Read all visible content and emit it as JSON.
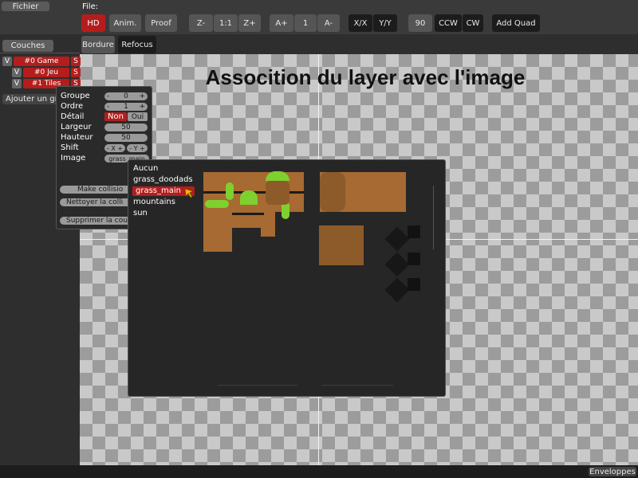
{
  "menubar": {
    "fichier": "Fichier",
    "file_label": "File:"
  },
  "toolbar": {
    "hd": "HD",
    "anim": "Anim.",
    "proof": "Proof",
    "zoom_out": "Z-",
    "zoom_reset": "1:1",
    "zoom_in": "Z+",
    "anim_speed_up": "A+",
    "anim_speed_value": "1",
    "anim_speed_down": "A-",
    "flip_x": "X/X",
    "flip_y": "Y/Y",
    "rotate_90": "90",
    "ccw": "CCW",
    "cw": "CW",
    "add_quad": "Add Quad",
    "border": "Bordure",
    "refocus": "Refocus"
  },
  "sidebar": {
    "tab": "Couches",
    "layers": [
      {
        "v": "V",
        "name": "#0 Game",
        "s": "S"
      },
      {
        "v": "V",
        "name": "#0 Jeu",
        "s": "S"
      },
      {
        "v": "V",
        "name": "#1 Tiles",
        "s": "S"
      }
    ],
    "add_group": "Ajouter un gr"
  },
  "properties": {
    "group_label": "Groupe",
    "group_value": "0",
    "order_label": "Ordre",
    "order_value": "1",
    "detail_label": "Détail",
    "detail_no": "Non",
    "detail_yes": "Oui",
    "width_label": "Largeur",
    "width_value": "50",
    "height_label": "Hauteur",
    "height_value": "50",
    "shift_label": "Shift",
    "shift_x": "- X +",
    "shift_y": "- Y +",
    "image_label": "Image",
    "image_value": "grass_main",
    "make_collision": "Make collisio",
    "clean_collision": "Nettoyer la colli",
    "delete_layer": "Supprimer la cou",
    "minus": "-",
    "plus": "+"
  },
  "image_picker": {
    "items": [
      "Aucun",
      "grass_doodads",
      "grass_main",
      "mountains",
      "sun"
    ],
    "selected": "grass_main"
  },
  "canvas": {
    "title": "Assocition du layer avec l'image"
  },
  "statusbar": {
    "envelopes": "Enveloppes"
  },
  "colors": {
    "accent": "#b51d1d",
    "bg": "#2e2e2e",
    "grass": "#7ed02e",
    "dirt": "#a66a32"
  },
  "icons": {
    "cursor": "mouse-pointer-icon"
  }
}
